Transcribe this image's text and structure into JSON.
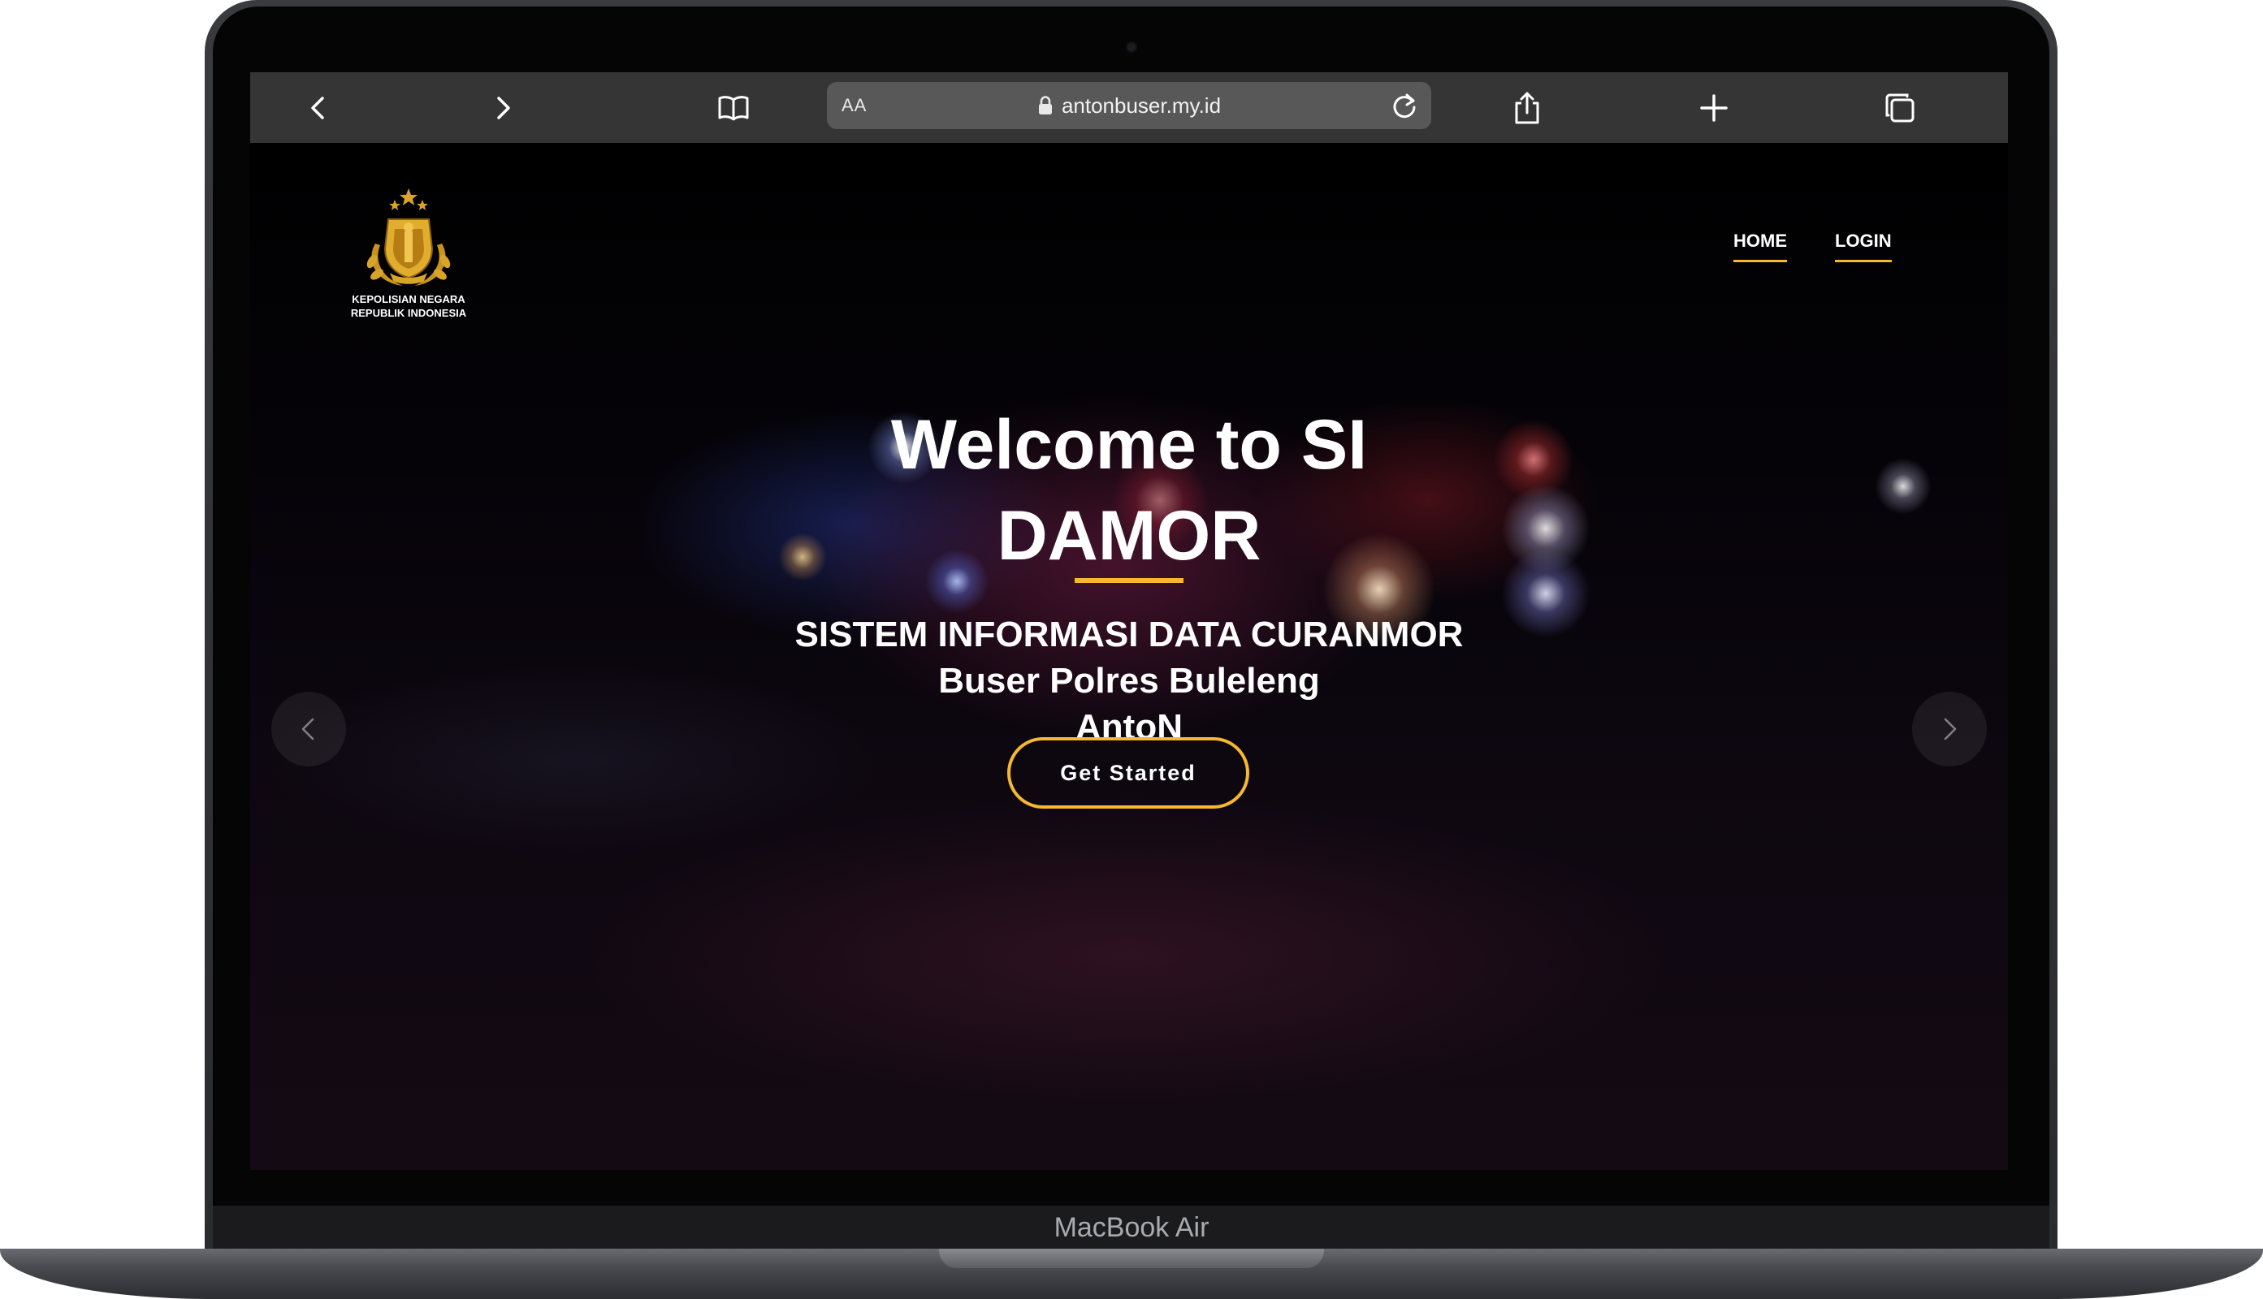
{
  "device": {
    "brand_label": "MacBook Air"
  },
  "browser": {
    "text_size_label": "AA",
    "url": "antonbuser.my.id",
    "icons": {
      "back": "chevron-left-icon",
      "forward": "chevron-right-icon",
      "bookmarks": "book-icon",
      "lock": "lock-icon",
      "reload": "reload-icon",
      "share": "share-icon",
      "new_tab": "plus-icon",
      "tabs": "tabs-icon"
    }
  },
  "site": {
    "logo": {
      "line1": "KEPOLISIAN NEGARA",
      "line2": "REPUBLIK INDONESIA"
    },
    "nav": {
      "home": "HOME",
      "login": "LOGIN"
    },
    "hero": {
      "title_line1": "Welcome to SI",
      "title_line2": "DAMOR",
      "subtitle_line1": "SISTEM INFORMASI DATA CURANMOR",
      "subtitle_line2": "Buser Polres Buleleng",
      "subtitle_line3": "AntoN",
      "cta_label": "Get Started"
    }
  },
  "colors": {
    "accent": "#f5b82e",
    "toolbar": "#353535",
    "address_bar": "#585858",
    "text": "#ffffff"
  }
}
